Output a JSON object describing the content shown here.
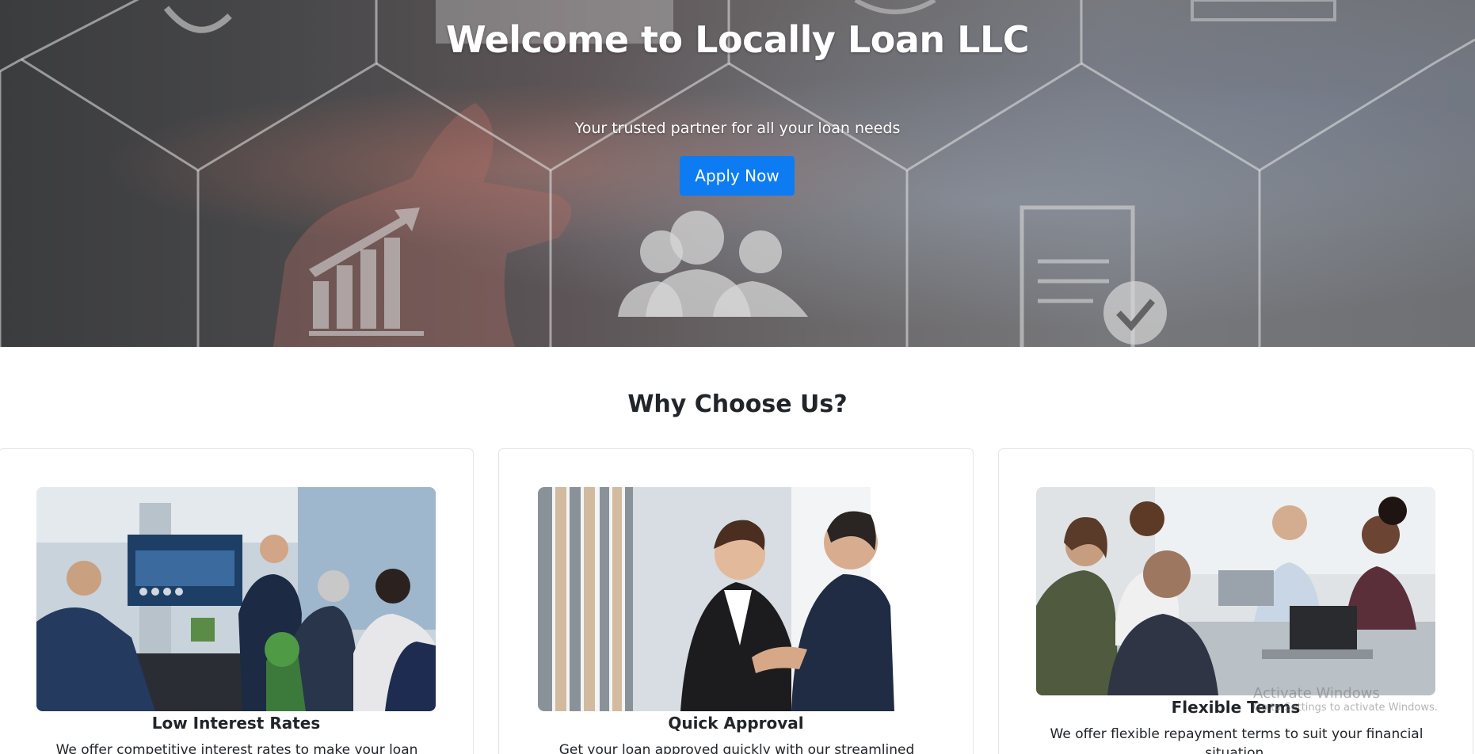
{
  "hero": {
    "title": "Welcome to Locally Loan LLC",
    "subtitle": "Your trusted partner for all your loan needs",
    "cta_label": "Apply Now",
    "cta_color": "#0d7cf2"
  },
  "why": {
    "title": "Why Choose Us?",
    "cards": [
      {
        "title": "Low Interest Rates",
        "text": "We offer competitive interest rates to make your loan",
        "image": "business-meeting-presentation-photo"
      },
      {
        "title": "Quick Approval",
        "text": "Get your loan approved quickly with our streamlined process.",
        "image": "business-handshake-photo"
      },
      {
        "title": "Flexible Terms",
        "text": "We offer flexible repayment terms to suit your financial situation.",
        "image": "team-meeting-photo"
      }
    ]
  },
  "overlay": {
    "watermark_line1": "Activate Windows",
    "watermark_line2": "Go to Settings to activate Windows."
  }
}
